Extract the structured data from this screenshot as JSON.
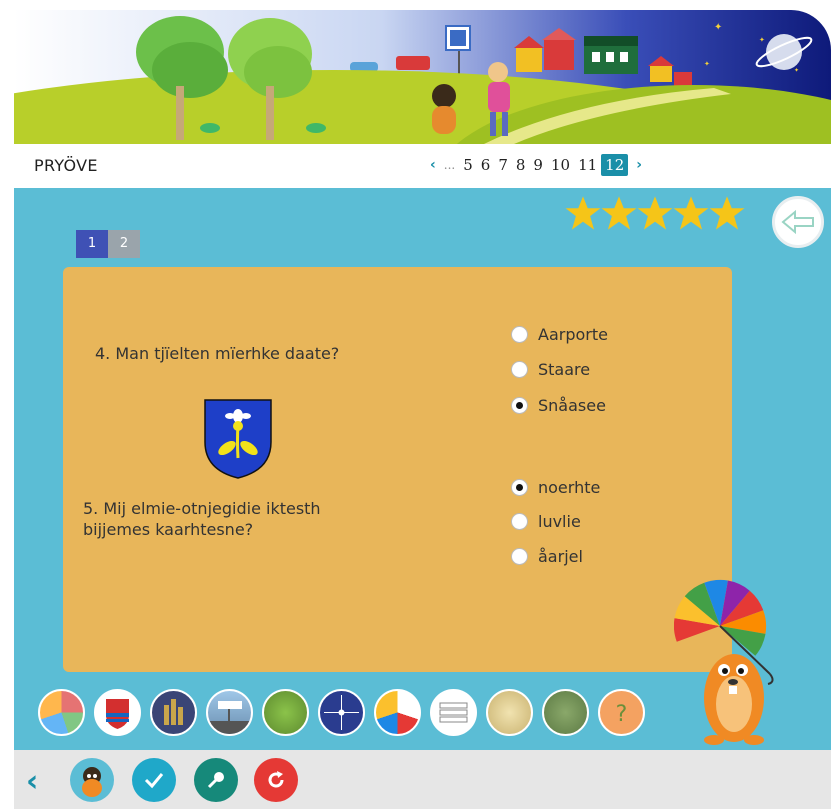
{
  "header": {
    "title": "PRYÖVE"
  },
  "pagination": {
    "prev": "‹",
    "ellipsis": "...",
    "pages": [
      "5",
      "6",
      "7",
      "8",
      "9",
      "10",
      "11"
    ],
    "current": "12",
    "next": "›"
  },
  "rating": {
    "stars": 5,
    "max": 5
  },
  "tabs": [
    {
      "label": "1"
    },
    {
      "label": "2"
    }
  ],
  "questions": [
    {
      "text": "4. Man tjïelten mïerhke daate?",
      "options": [
        "Aarporte",
        "Staare",
        "Snåasee"
      ],
      "selected": 2
    },
    {
      "text": "5. Mij elmie-otnjegidie iktesth bijjemes kaarhtesne?",
      "options": [
        "noerhte",
        "luvlie",
        "åarjel"
      ],
      "selected": 0
    }
  ],
  "icon_row": [
    "map-icon",
    "coat-of-arms-icon",
    "city-icon",
    "road-sign-icon",
    "landscape-icon",
    "compass-icon",
    "map-region-icon",
    "list-icon",
    "route-map-icon",
    "terrain-icon",
    "help-icon"
  ],
  "toolbar": {
    "back": "‹",
    "buttons": [
      "avatar-icon",
      "check-icon",
      "key-icon",
      "reset-icon"
    ]
  },
  "colors": {
    "accent": "#1a8fa8",
    "main_bg": "#5bbdd5",
    "card_bg": "#e8b65a",
    "star": "#f5c518",
    "check_btn": "#1fa8c9",
    "key_btn": "#16897a",
    "reset_btn": "#e53935",
    "shield_blue": "#1e3fc8",
    "shield_yellow": "#f2e21a"
  }
}
